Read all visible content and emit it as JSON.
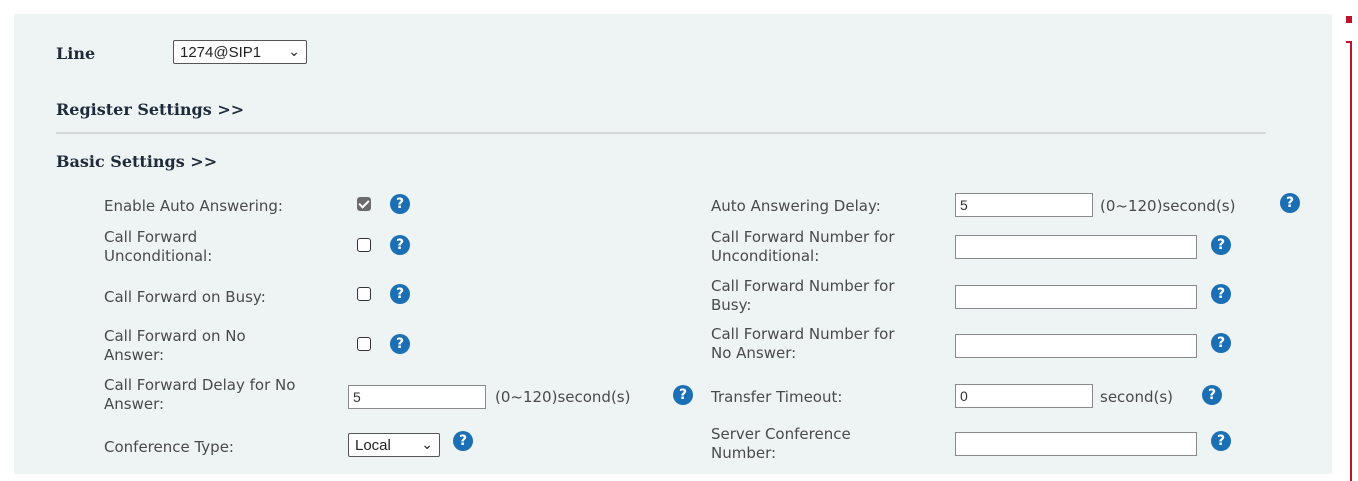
{
  "line": {
    "label": "Line",
    "selected": "1274@SIP1"
  },
  "register_settings": "Register Settings >>",
  "basic_settings": "Basic Settings >>",
  "help_glyph": "?",
  "select_chevron": "⌄",
  "colors": {
    "panel_bg": "#eef3f4",
    "help_icon": "#1a6fb5",
    "accent_red": "#c0102a"
  },
  "left_fields": {
    "auto_answer": {
      "label": "Enable Auto Answering:",
      "checked": true
    },
    "cf_unconditional": {
      "label_line1": "Call Forward",
      "label_line2": "Unconditional:",
      "checked": false
    },
    "cf_busy": {
      "label": "Call Forward on Busy:",
      "checked": false
    },
    "cf_no_answer": {
      "label_line1": "Call Forward on No",
      "label_line2": "Answer:",
      "checked": false
    },
    "cf_delay": {
      "label_line1": "Call Forward Delay for No",
      "label_line2": "Answer:",
      "value": "5",
      "unit": "(0~120)second(s)"
    },
    "conference_type": {
      "label": "Conference Type:",
      "selected": "Local"
    }
  },
  "right_fields": {
    "auto_answer_delay": {
      "label": "Auto Answering Delay:",
      "value": "5",
      "unit": "(0~120)second(s)"
    },
    "cf_number_unconditional": {
      "label_line1": "Call Forward Number for",
      "label_line2": "Unconditional:",
      "value": ""
    },
    "cf_number_busy": {
      "label_line1": "Call Forward Number for",
      "label_line2": "Busy:",
      "value": ""
    },
    "cf_number_no_answer": {
      "label_line1": "Call Forward Number for",
      "label_line2": "No Answer:",
      "value": ""
    },
    "transfer_timeout": {
      "label": "Transfer Timeout:",
      "value": "0",
      "unit": "second(s)"
    },
    "server_conference_number": {
      "label_line1": "Server Conference",
      "label_line2": "Number:",
      "value": ""
    }
  }
}
